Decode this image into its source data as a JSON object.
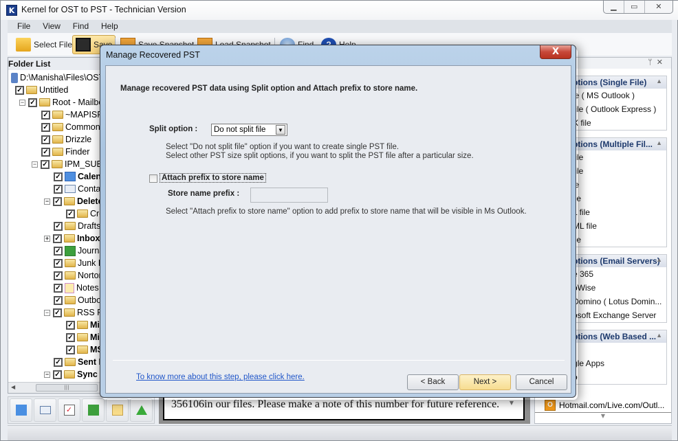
{
  "window": {
    "title": "Kernel for OST to PST - Technician Version",
    "app_icon": "K",
    "controls": [
      "minimize",
      "maximize",
      "close"
    ]
  },
  "menu": [
    "File",
    "View",
    "Find",
    "Help"
  ],
  "toolbar": {
    "select_file": "Select File",
    "save": "Save",
    "save_snapshot": "Save Snapshot",
    "load_snapshot": "Load Snapshot",
    "find": "Find",
    "help": "Help"
  },
  "folder_list": {
    "title": "Folder List",
    "root_path": "D:\\Manisha\\Files\\OST",
    "items": [
      {
        "label": "Untitled",
        "level": 0,
        "bold": false,
        "icon": "folder",
        "expander": ""
      },
      {
        "label": "Root - Mailbox",
        "level": 1,
        "bold": false,
        "icon": "folder",
        "expander": "−"
      },
      {
        "label": "~MAPISP(Internal)",
        "level": 2,
        "bold": false,
        "icon": "folder",
        "expander": ""
      },
      {
        "label": "Common Views",
        "level": 2,
        "bold": false,
        "icon": "folder",
        "expander": ""
      },
      {
        "label": "Drizzle",
        "level": 2,
        "bold": false,
        "icon": "folder",
        "expander": ""
      },
      {
        "label": "Finder",
        "level": 2,
        "bold": false,
        "icon": "folder",
        "expander": ""
      },
      {
        "label": "IPM_SUBTREE",
        "level": 2,
        "bold": false,
        "icon": "folder",
        "expander": "−"
      },
      {
        "label": "Calendar",
        "level": 3,
        "bold": true,
        "icon": "calendar",
        "expander": ""
      },
      {
        "label": "Contacts",
        "level": 3,
        "bold": false,
        "icon": "contact",
        "expander": ""
      },
      {
        "label": "Deleted Items",
        "level": 3,
        "bold": true,
        "icon": "folder",
        "expander": "−"
      },
      {
        "label": "Created",
        "level": 4,
        "bold": false,
        "icon": "folder",
        "expander": ""
      },
      {
        "label": "Drafts",
        "level": 3,
        "bold": false,
        "icon": "folder",
        "expander": ""
      },
      {
        "label": "Inbox",
        "level": 3,
        "bold": true,
        "icon": "folder",
        "expander": "+"
      },
      {
        "label": "Journal",
        "level": 3,
        "bold": false,
        "icon": "journal",
        "expander": ""
      },
      {
        "label": "Junk E-mail",
        "level": 3,
        "bold": false,
        "icon": "folder",
        "expander": ""
      },
      {
        "label": "Norton",
        "level": 3,
        "bold": false,
        "icon": "folder",
        "expander": ""
      },
      {
        "label": "Notes",
        "level": 3,
        "bold": false,
        "icon": "notes",
        "expander": ""
      },
      {
        "label": "Outbox",
        "level": 3,
        "bold": false,
        "icon": "folder",
        "expander": ""
      },
      {
        "label": "RSS Feeds",
        "level": 3,
        "bold": false,
        "icon": "folder",
        "expander": "−"
      },
      {
        "label": "Mic",
        "level": 4,
        "bold": true,
        "icon": "folder",
        "expander": ""
      },
      {
        "label": "Mic",
        "level": 4,
        "bold": true,
        "icon": "folder",
        "expander": ""
      },
      {
        "label": "MS",
        "level": 4,
        "bold": true,
        "icon": "folder",
        "expander": ""
      },
      {
        "label": "Sent Items",
        "level": 3,
        "bold": true,
        "icon": "folder",
        "expander": ""
      },
      {
        "label": "Sync Issues",
        "level": 3,
        "bold": true,
        "icon": "folder",
        "expander": "−"
      }
    ]
  },
  "nav_buttons": [
    "calendar-icon",
    "contacts-icon",
    "tasks-icon",
    "journal-icon",
    "notes-icon",
    "up-arrow-icon"
  ],
  "message": {
    "text": "356106in our files. Please make a note of this number for future reference."
  },
  "saving_options": {
    "groups": [
      {
        "title": "Saving Options (Single File)",
        "visible_title": "ptions (Single File)",
        "items": [
          "le ( MS Outlook )",
          "file ( Outlook Express )",
          "X file"
        ]
      },
      {
        "title": "Saving Options (Multiple Files)",
        "visible_title": "ptions (Multiple Fil...",
        "items": [
          "file",
          "file",
          "le",
          "ile",
          "L file",
          "ML file",
          "ile"
        ]
      },
      {
        "title": "Saving Options (Email Servers)",
        "visible_title": "ptions (Email Servers)",
        "items": [
          "e 365",
          "pWise",
          "Domino ( Lotus Domin...",
          "osoft Exchange Server"
        ]
      },
      {
        "title": "Saving Options (Web Based ...)",
        "visible_title": "ptions (Web Based ...",
        "items": [
          "l",
          "gle Apps",
          "o"
        ]
      }
    ],
    "bottom_item": "Hotmail.com/Live.com/Outl..."
  },
  "dialog": {
    "title": "Manage Recovered PST",
    "close_label": "X",
    "heading": "Manage recovered PST data using Split option and Attach prefix to store name.",
    "split_label": "Split option :",
    "split_value": "Do not split file",
    "split_help_1": "Select \"Do not split file\" option if you want to create single PST file.",
    "split_help_2": "Select other PST size split options, if you want to split the PST file after a particular size.",
    "attach_label": "Attach prefix to store name",
    "attach_checked": false,
    "prefix_label": "Store name prefix :",
    "prefix_value": "",
    "prefix_help": "Select \"Attach prefix to store name\" option to add prefix to store name that will be visible in Ms Outlook.",
    "help_link": "To know more about this step, please click here.",
    "back": "< Back",
    "next": "Next >",
    "cancel": "Cancel"
  }
}
